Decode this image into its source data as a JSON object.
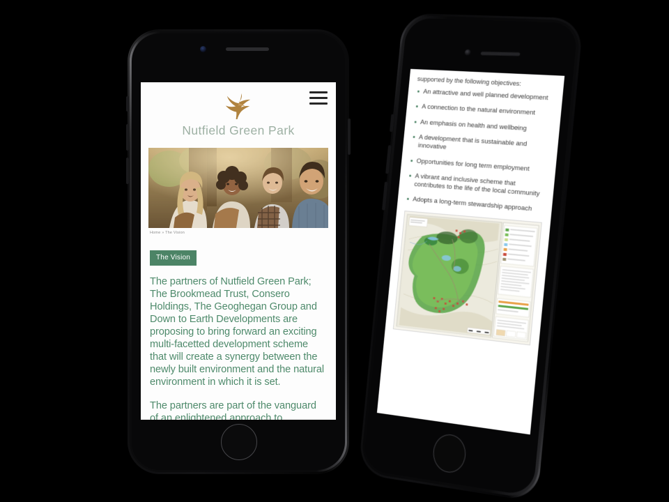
{
  "mockup": {
    "title": "Nutfield Green Park responsive mobile mockup",
    "background_color": "#000000"
  },
  "left_phone": {
    "device_name": "black-smartphone-front",
    "hardware": {
      "speaker": "earpiece-speaker",
      "camera": "front-camera",
      "home_button": "home-button",
      "buttons": [
        "mute-switch",
        "volume-up",
        "volume-down",
        "power-button"
      ]
    },
    "page": {
      "header": {
        "logo_icon": "hummingbird-logo-icon",
        "logo_color": "#b0833f",
        "site_title": "Nutfield Green Park",
        "site_title_color": "#9db0a3",
        "menu_icon": "hamburger-menu-icon"
      },
      "hero": {
        "image_name": "children-playing-outdoors-photo",
        "alt": "Four smiling children sitting together outdoors among trees"
      },
      "breadcrumb": {
        "home": "Home",
        "separator": "»",
        "current": "The Vision",
        "full": "Home » The Vision"
      },
      "badge": {
        "label": "The Vision",
        "background": "#4c8466",
        "text_color": "#ffffff"
      },
      "paragraphs": [
        "The partners of Nutfield Green Park; The Brookmead Trust, Consero Holdings, The Geoghegan Group and Down to Earth Developments are proposing to bring forward an exciting multi-facetted development scheme that will create a synergy between the newly built environment and the natural environment in which it is set.",
        "The partners are part of the vanguard of an enlightened approach to"
      ],
      "body_text_color": "#4e8a6b"
    }
  },
  "right_phone": {
    "device_name": "black-smartphone-tilted",
    "hardware": {
      "speaker": "earpiece-speaker",
      "camera": "front-camera",
      "home_button": "home-button",
      "buttons": [
        "mute-switch",
        "volume-up",
        "volume-down"
      ]
    },
    "page": {
      "lead_text": "supported by the following objectives:",
      "objectives": [
        "An attractive and well planned development",
        "A connection to the natural environment",
        "An emphasis on health and wellbeing",
        "A development that is sustainable and innovative",
        "Opportunities for long term employment",
        "A vibrant and inclusive scheme that contributes to the life of the local community",
        "Adopts a long-term stewardship approach"
      ],
      "bullet_color": "#4c8466",
      "text_color": "#3c3c3c",
      "map": {
        "image_name": "site-masterplan-map",
        "alt": "Coloured masterplan site layout drawing with green landscaped zones and a legend panel"
      }
    }
  }
}
